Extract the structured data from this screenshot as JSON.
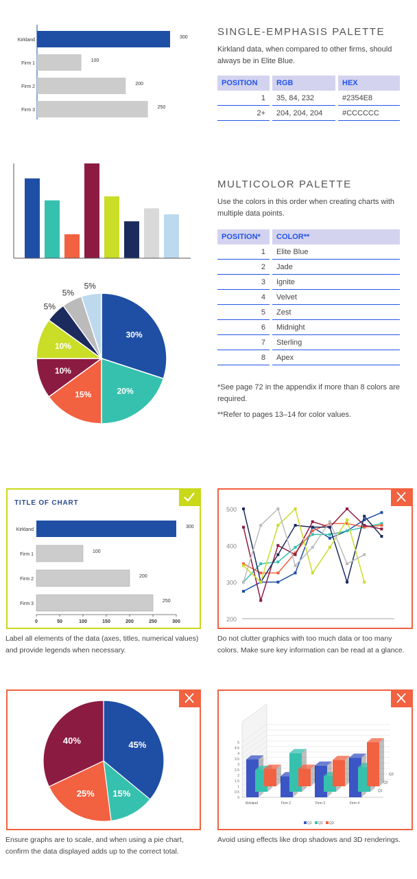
{
  "colors": {
    "elite_blue": "#2354E8",
    "bar_blue": "#1E4FA5",
    "grey": "#CCCCCC",
    "jade": "#36C1AE",
    "ignite": "#F26140",
    "velvet": "#8C1B42",
    "zest": "#CADD27",
    "midnight": "#1C2B5E",
    "sterling": "#D9D9D9",
    "sky": "#BDD9EE",
    "good": "#C9D81B",
    "bad": "#F26140"
  },
  "single": {
    "title": "SINGLE-EMPHASIS PALETTE",
    "desc": "Kirkland data, when compared to other firms, should always be in Elite Blue.",
    "headers": [
      "POSITION",
      "RGB",
      "HEX"
    ],
    "rows": [
      {
        "position": "1",
        "rgb": "35, 84, 232",
        "hex": "#2354E8"
      },
      {
        "position": "2+",
        "rgb": "204, 204, 204",
        "hex": "#CCCCCC"
      }
    ]
  },
  "multi": {
    "title": "MULTICOLOR PALETTE",
    "desc": "Use the colors in this order when creating charts with multiple data points.",
    "headers": [
      "POSITION*",
      "COLOR**"
    ],
    "rows": [
      {
        "position": "1",
        "color": "Elite Blue"
      },
      {
        "position": "2",
        "color": "Jade"
      },
      {
        "position": "3",
        "color": "Ignite"
      },
      {
        "position": "4",
        "color": "Velvet"
      },
      {
        "position": "5",
        "color": "Zest"
      },
      {
        "position": "6",
        "color": "Midnight"
      },
      {
        "position": "7",
        "color": "Sterling"
      },
      {
        "position": "8",
        "color": "Apex"
      }
    ],
    "note1": "*See page 72 in the appendix if more than 8 colors are required.",
    "note2": "**Refer to pages 13–14 for color values."
  },
  "captions": {
    "c1": "Label all elements of the data (axes, titles, numerical values) and provide legends when necessary.",
    "c2": "Do not clutter graphics with too much data or too many colors. Make sure key information can be read at a glance.",
    "c3": "Ensure graphs are to scale, and when using a pie chart, confirm the data displayed adds up to the correct total.",
    "c4": "Avoid using effects like drop shadows and 3D renderings."
  },
  "icons": {
    "check": "check-icon",
    "cross": "close-icon"
  },
  "chart_data": [
    {
      "id": "hbar1",
      "type": "bar",
      "orientation": "horizontal",
      "categories": [
        "Kirkland",
        "Firm 1",
        "Firm 2",
        "Firm 3"
      ],
      "values": [
        300,
        100,
        200,
        250
      ],
      "value_labels": [
        "300",
        "100",
        "200",
        "250"
      ],
      "xlim": [
        0,
        300
      ]
    },
    {
      "id": "vbar",
      "type": "bar",
      "values": [
        80,
        58,
        24,
        95,
        62,
        37,
        50,
        44
      ],
      "colors": [
        "#1E4FA5",
        "#36C1AE",
        "#F26140",
        "#8C1B42",
        "#CADD27",
        "#1C2B5E",
        "#D9D9D9",
        "#BDD9EE"
      ]
    },
    {
      "id": "pie1",
      "type": "pie",
      "values": [
        30,
        20,
        15,
        10,
        10,
        5,
        5,
        5
      ],
      "labels": [
        "30%",
        "20%",
        "15%",
        "10%",
        "10%",
        "5%",
        "5%",
        "5%"
      ],
      "colors": [
        "#1E4FA5",
        "#36C1AE",
        "#F26140",
        "#8C1B42",
        "#CADD27",
        "#1C2B5E",
        "#BBBBBB",
        "#BDD9EE"
      ]
    },
    {
      "id": "hbar2",
      "type": "bar",
      "orientation": "horizontal",
      "title": "TITLE OF CHART",
      "categories": [
        "Kirkland",
        "Firm 1",
        "Firm 2",
        "Firm 3"
      ],
      "values": [
        300,
        100,
        200,
        250
      ],
      "value_labels": [
        "300",
        "100",
        "200",
        "250"
      ],
      "xlim": [
        0,
        300
      ],
      "xticks": [
        "0",
        "50",
        "100",
        "150",
        "200",
        "250",
        "300"
      ]
    },
    {
      "id": "clutter",
      "type": "line",
      "ylim": [
        200,
        500
      ],
      "yticks": [
        "200",
        "300",
        "400",
        "500"
      ],
      "x": [
        1,
        2,
        3,
        4,
        5,
        6,
        7,
        8,
        9,
        10
      ],
      "series": [
        {
          "color": "#1E4FA5",
          "values": [
            275,
            300,
            300,
            325,
            450,
            420,
            440,
            470,
            490,
            null
          ]
        },
        {
          "color": "#36C1AE",
          "values": [
            300,
            350,
            355,
            395,
            430,
            430,
            440,
            450,
            460,
            null
          ]
        },
        {
          "color": "#F26140",
          "values": [
            350,
            325,
            325,
            380,
            440,
            460,
            460,
            450,
            455,
            null
          ]
        },
        {
          "color": "#8C1B42",
          "values": [
            450,
            250,
            400,
            375,
            465,
            450,
            500,
            455,
            445,
            null
          ]
        },
        {
          "color": "#1C2B5E",
          "values": [
            500,
            300,
            375,
            455,
            450,
            450,
            300,
            480,
            425,
            null
          ]
        },
        {
          "color": "#CADD27",
          "values": [
            345,
            300,
            455,
            500,
            325,
            395,
            470,
            300,
            null,
            null
          ]
        },
        {
          "color": "#BBBBBB",
          "values": [
            300,
            455,
            500,
            345,
            395,
            465,
            350,
            375,
            null,
            null
          ]
        }
      ]
    },
    {
      "id": "pie2",
      "type": "pie",
      "values": [
        45,
        15,
        25,
        40
      ],
      "labels": [
        "45%",
        "15%",
        "25%",
        "40%"
      ],
      "colors": [
        "#1E4FA5",
        "#36C1AE",
        "#F26140",
        "#8C1B42"
      ]
    },
    {
      "id": "bar3d",
      "type": "bar",
      "categories": [
        "Kirkland",
        "Firm 2",
        "Firm 3",
        "Firm 4"
      ],
      "yticks": [
        "0",
        "0.5",
        "1",
        "1.5",
        "2",
        "2.5",
        "3",
        "3.5",
        "4",
        "4.5",
        "5"
      ],
      "series": [
        {
          "name": "Q1",
          "color": "#3B56C4",
          "values": [
            4.3,
            2.4,
            3.6,
            4.5
          ]
        },
        {
          "name": "Q2",
          "color": "#36C1AE",
          "values": [
            2.5,
            4.4,
            1.8,
            2.8
          ]
        },
        {
          "name": "Q3",
          "color": "#F26140",
          "values": [
            2.0,
            2.0,
            3.0,
            5.0
          ]
        }
      ],
      "depth_labels": [
        "Q1",
        "Q2",
        "Q3"
      ]
    }
  ]
}
